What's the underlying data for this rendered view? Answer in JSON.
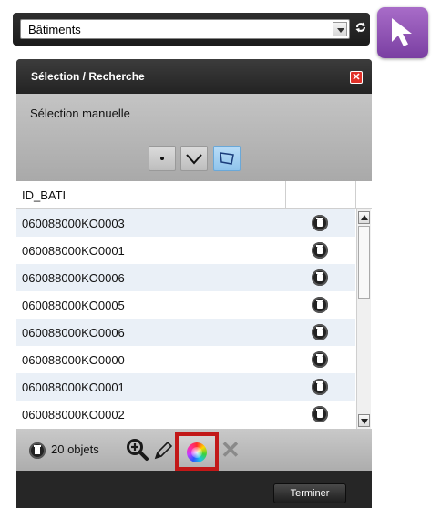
{
  "toolbar": {
    "layer_select_value": "Bâtiments",
    "refresh_icon": "refresh-icon",
    "cursor_icon": "cursor-arrow-icon"
  },
  "panel": {
    "title": "Sélection / Recherche",
    "close_icon": "close-icon",
    "section_label": "Sélection manuelle",
    "tools": [
      "point-icon",
      "line-icon",
      "polygon-icon"
    ],
    "table": {
      "column_header": "ID_BATI",
      "rows": [
        {
          "id": "060088000KO0003"
        },
        {
          "id": "060088000KO0001"
        },
        {
          "id": "060088000KO0006"
        },
        {
          "id": "060088000KO0005"
        },
        {
          "id": "060088000KO0006"
        },
        {
          "id": "060088000KO0000"
        },
        {
          "id": "060088000KO0001"
        },
        {
          "id": "060088000KO0002"
        }
      ]
    },
    "footer": {
      "count_label": "20 objets",
      "icons": [
        "trash-icon",
        "zoom-in-icon",
        "pencil-icon",
        "color-wheel-icon",
        "clear-x-icon"
      ]
    },
    "finish_label": "Terminer"
  },
  "colors": {
    "accent_purple": "#8e4fb5",
    "highlight_red": "#c21818",
    "polygon_tool_blue": "#8fc4ec",
    "row_alt": "#eaf0f7"
  }
}
